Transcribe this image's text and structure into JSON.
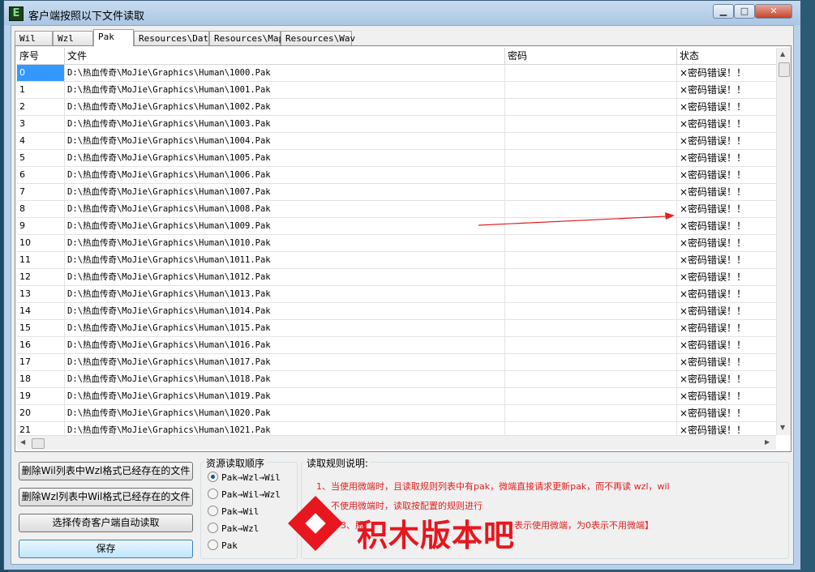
{
  "window": {
    "title": "客户端按照以下文件读取",
    "min_label": "▁",
    "max_label": "□",
    "close_label": "✕"
  },
  "tabs": [
    "Wil",
    "Wzl",
    "Pak",
    "Resources\\Data",
    "Resources\\Map",
    "Resources\\Wav"
  ],
  "active_tab": "Pak",
  "table": {
    "headers": [
      "序号",
      "文件",
      "密码",
      "状态"
    ],
    "rows": [
      {
        "idx": "0",
        "file": "D:\\热血传奇\\MoJie\\Graphics\\Human\\1000.Pak",
        "pwd": "",
        "status": "×密码错误！！"
      },
      {
        "idx": "1",
        "file": "D:\\热血传奇\\MoJie\\Graphics\\Human\\1001.Pak",
        "pwd": "",
        "status": "×密码错误！！"
      },
      {
        "idx": "2",
        "file": "D:\\热血传奇\\MoJie\\Graphics\\Human\\1002.Pak",
        "pwd": "",
        "status": "×密码错误！！"
      },
      {
        "idx": "3",
        "file": "D:\\热血传奇\\MoJie\\Graphics\\Human\\1003.Pak",
        "pwd": "",
        "status": "×密码错误！！"
      },
      {
        "idx": "4",
        "file": "D:\\热血传奇\\MoJie\\Graphics\\Human\\1004.Pak",
        "pwd": "",
        "status": "×密码错误！！"
      },
      {
        "idx": "5",
        "file": "D:\\热血传奇\\MoJie\\Graphics\\Human\\1005.Pak",
        "pwd": "",
        "status": "×密码错误！！"
      },
      {
        "idx": "6",
        "file": "D:\\热血传奇\\MoJie\\Graphics\\Human\\1006.Pak",
        "pwd": "",
        "status": "×密码错误！！"
      },
      {
        "idx": "7",
        "file": "D:\\热血传奇\\MoJie\\Graphics\\Human\\1007.Pak",
        "pwd": "",
        "status": "×密码错误！！"
      },
      {
        "idx": "8",
        "file": "D:\\热血传奇\\MoJie\\Graphics\\Human\\1008.Pak",
        "pwd": "",
        "status": "×密码错误！！"
      },
      {
        "idx": "9",
        "file": "D:\\热血传奇\\MoJie\\Graphics\\Human\\1009.Pak",
        "pwd": "",
        "status": "×密码错误！！"
      },
      {
        "idx": "10",
        "file": "D:\\热血传奇\\MoJie\\Graphics\\Human\\1010.Pak",
        "pwd": "",
        "status": "×密码错误！！"
      },
      {
        "idx": "11",
        "file": "D:\\热血传奇\\MoJie\\Graphics\\Human\\1011.Pak",
        "pwd": "",
        "status": "×密码错误！！"
      },
      {
        "idx": "12",
        "file": "D:\\热血传奇\\MoJie\\Graphics\\Human\\1012.Pak",
        "pwd": "",
        "status": "×密码错误！！"
      },
      {
        "idx": "13",
        "file": "D:\\热血传奇\\MoJie\\Graphics\\Human\\1013.Pak",
        "pwd": "",
        "status": "×密码错误！！"
      },
      {
        "idx": "14",
        "file": "D:\\热血传奇\\MoJie\\Graphics\\Human\\1014.Pak",
        "pwd": "",
        "status": "×密码错误！！"
      },
      {
        "idx": "15",
        "file": "D:\\热血传奇\\MoJie\\Graphics\\Human\\1015.Pak",
        "pwd": "",
        "status": "×密码错误！！"
      },
      {
        "idx": "16",
        "file": "D:\\热血传奇\\MoJie\\Graphics\\Human\\1016.Pak",
        "pwd": "",
        "status": "×密码错误！！"
      },
      {
        "idx": "17",
        "file": "D:\\热血传奇\\MoJie\\Graphics\\Human\\1017.Pak",
        "pwd": "",
        "status": "×密码错误！！"
      },
      {
        "idx": "18",
        "file": "D:\\热血传奇\\MoJie\\Graphics\\Human\\1018.Pak",
        "pwd": "",
        "status": "×密码错误！！"
      },
      {
        "idx": "19",
        "file": "D:\\热血传奇\\MoJie\\Graphics\\Human\\1019.Pak",
        "pwd": "",
        "status": "×密码错误！！"
      },
      {
        "idx": "20",
        "file": "D:\\热血传奇\\MoJie\\Graphics\\Human\\1020.Pak",
        "pwd": "",
        "status": "×密码错误！！"
      },
      {
        "idx": "21",
        "file": "D:\\热血传奇\\MoJie\\Graphics\\Human\\1021.Pak",
        "pwd": "",
        "status": "×密码错误！！"
      }
    ]
  },
  "buttons": {
    "delete_wil": "删除Wil列表中Wzl格式已经存在的文件",
    "delete_wzl": "删除Wzl列表中Wil格式已经存在的文件",
    "auto_read": "选择传奇客户端自动读取",
    "save": "保存"
  },
  "read_order": {
    "label": "资源读取顺序",
    "options": [
      "Pak→Wzl→Wil",
      "Pak→Wil→Wzl",
      "Pak→Wil",
      "Pak→Wzl",
      "Pak"
    ],
    "selected": "Pak→Wzl→Wil"
  },
  "rules": {
    "label": "读取规则说明:",
    "lines": [
      "1、当使用微端时，且读取规则列表中有pak，微端直接请求更新pak，而不再读 wzl，wil",
      "2、不使用微端时，读取按配置的规则进行",
      "3、服",
      "表示使用微端，为0表示不用微端】"
    ]
  },
  "watermark": {
    "text": "积木版本吧",
    "color": "#e8161e"
  },
  "colors": {
    "selection": "#3399ff",
    "rule_text": "#e02020",
    "annotation_arrow": "#e02020"
  }
}
